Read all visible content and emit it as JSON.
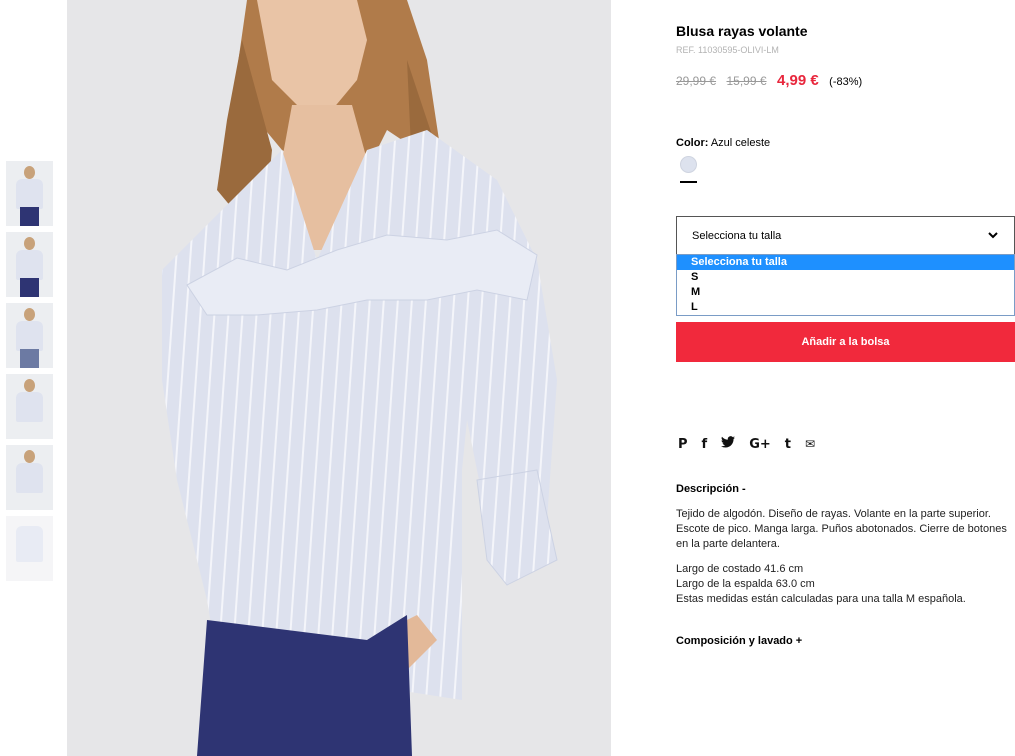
{
  "product": {
    "title": "Blusa rayas volante",
    "ref": "REF. 11030595-OLIVI-LM",
    "old_price_1": "29,99 €",
    "old_price_2": "15,99 €",
    "price": "4,99 €",
    "discount": "(-83%)"
  },
  "color": {
    "label": "Color:",
    "value": "Azul celeste",
    "swatch_color": "#dde2ee"
  },
  "size_select": {
    "selected": "Selecciona tu talla",
    "options": [
      "Selecciona tu talla",
      "S",
      "M",
      "L"
    ]
  },
  "add_button": "Añadir a la bolsa",
  "social": {
    "pinterest": "P",
    "facebook": "f",
    "twitter": "t",
    "googleplus": "G+",
    "tumblr": "t",
    "email": "✉"
  },
  "description": {
    "heading": "Descripción  -",
    "text": "Tejido de algodón. Diseño de rayas. Volante en la parte superior. Escote de pico. Manga larga. Puños abotonados. Cierre de botones en la parte delantera.",
    "measure_1": "Largo de costado 41.6 cm",
    "measure_2": "Largo de la espalda 63.0 cm",
    "measure_3": "Estas medidas están calculadas para una talla M española."
  },
  "composition": {
    "heading": "Composición y lavado  +"
  },
  "colors": {
    "accent": "#f1293c",
    "sale_price": "#e8263c",
    "dropdown_highlight": "#1e90ff",
    "shirt": "#dfe3ef",
    "pants": "#2e3473"
  }
}
